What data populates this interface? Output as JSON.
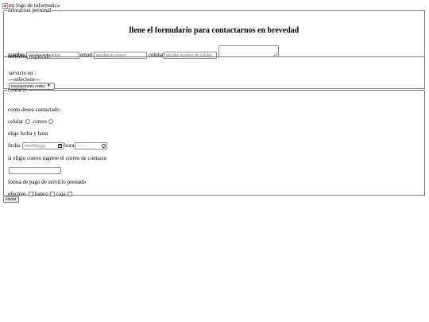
{
  "logo": {
    "alt_text": "mi logo de informatica"
  },
  "personal": {
    "legend": "inforacion personal",
    "heading": "llene el formulario para contactarnos en brevedad",
    "nombre_label": "nombre",
    "nombre_placeholder": "escribe tu nombre",
    "email_label": "email",
    "email_placeholder": "escribe tu correo",
    "celular_label": "celular",
    "celular_placeholder": "escribe numero de celular"
  },
  "servicios": {
    "legend": "servicios requerido",
    "prompt": "servicio en :",
    "placeholder_option": "---selecione---",
    "selected_option": "instalaciones redes"
  },
  "contacto": {
    "legend": "contacto",
    "como_label": "como desea contactado",
    "celular_label": "celular",
    "correo_label": "correo",
    "fecha_hora_label": "elige fecha y hora",
    "fecha_label": "fecha",
    "date_placeholder": "mm/dd/yyyy",
    "hora_label": "hora",
    "time_placeholder": "--:-- --",
    "correo_prompt": "si eligio correo ingrese el correo de contacto",
    "pago_label": "forma de pago de servicio prestado",
    "efectivo_label": "efectivo",
    "banco_label": "banco",
    "caja_label": "caja"
  },
  "submit_label": "enviar"
}
